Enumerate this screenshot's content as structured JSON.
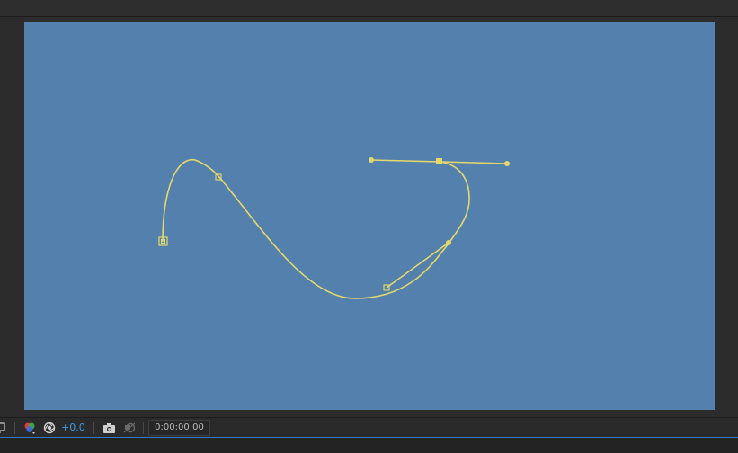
{
  "viewer": {
    "background_color": "#5380ad",
    "path_color": "#e6d96b"
  },
  "bottom_toolbar": {
    "region_icon": "region-of-interest-icon",
    "channel_icon": "color-channels-icon",
    "exposure_icon": "reset-exposure-icon",
    "exposure_value": "+0.0",
    "snapshot_icon": "camera-snapshot-icon",
    "show_snapshot_icon": "show-snapshot-icon",
    "timecode": "0:00:00:00",
    "accent_color": "#3d9be9"
  }
}
